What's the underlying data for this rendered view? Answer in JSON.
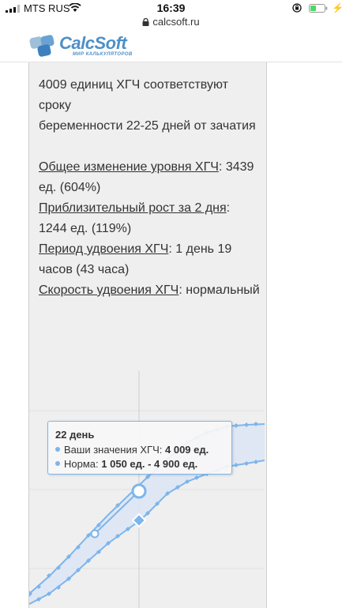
{
  "status_bar": {
    "carrier": "MTS RUS",
    "time": "16:39",
    "bolt": "⚡"
  },
  "url_bar": {
    "domain": "calcsoft.ru"
  },
  "header": {
    "logo_text": "CalcSoft",
    "logo_subtitle": "МИР КАЛЬКУЛЯТОРОВ"
  },
  "results": {
    "line1": "4009 единиц ХГЧ соответствуют сроку",
    "line2": "беременности 22-25 дней от зачатия",
    "total_change_label": "Общее изменение уровня ХГЧ",
    "total_change_value": "3439 ед. (604%)",
    "growth_label": "Приблизительный рост за 2 дня",
    "growth_value": "1244 ед. (119%)",
    "doubling_period_label": "Период удвоения ХГЧ",
    "doubling_period_value": "1 день 19 часов (43 часа)",
    "doubling_speed_label": "Скорость удвоения ХГЧ",
    "doubling_speed_value": "нормальный"
  },
  "tooltip": {
    "title": "22 день",
    "your_label": "Ваши значения ХГЧ:",
    "your_value": "4 009 ед.",
    "norm_label": "Норма:",
    "norm_value": "1 050 ед. - 4 900 ед."
  },
  "colors": {
    "series": "#7cb5ec",
    "band": "#dde6f5",
    "accent_logo": "#4e8fc8"
  }
}
